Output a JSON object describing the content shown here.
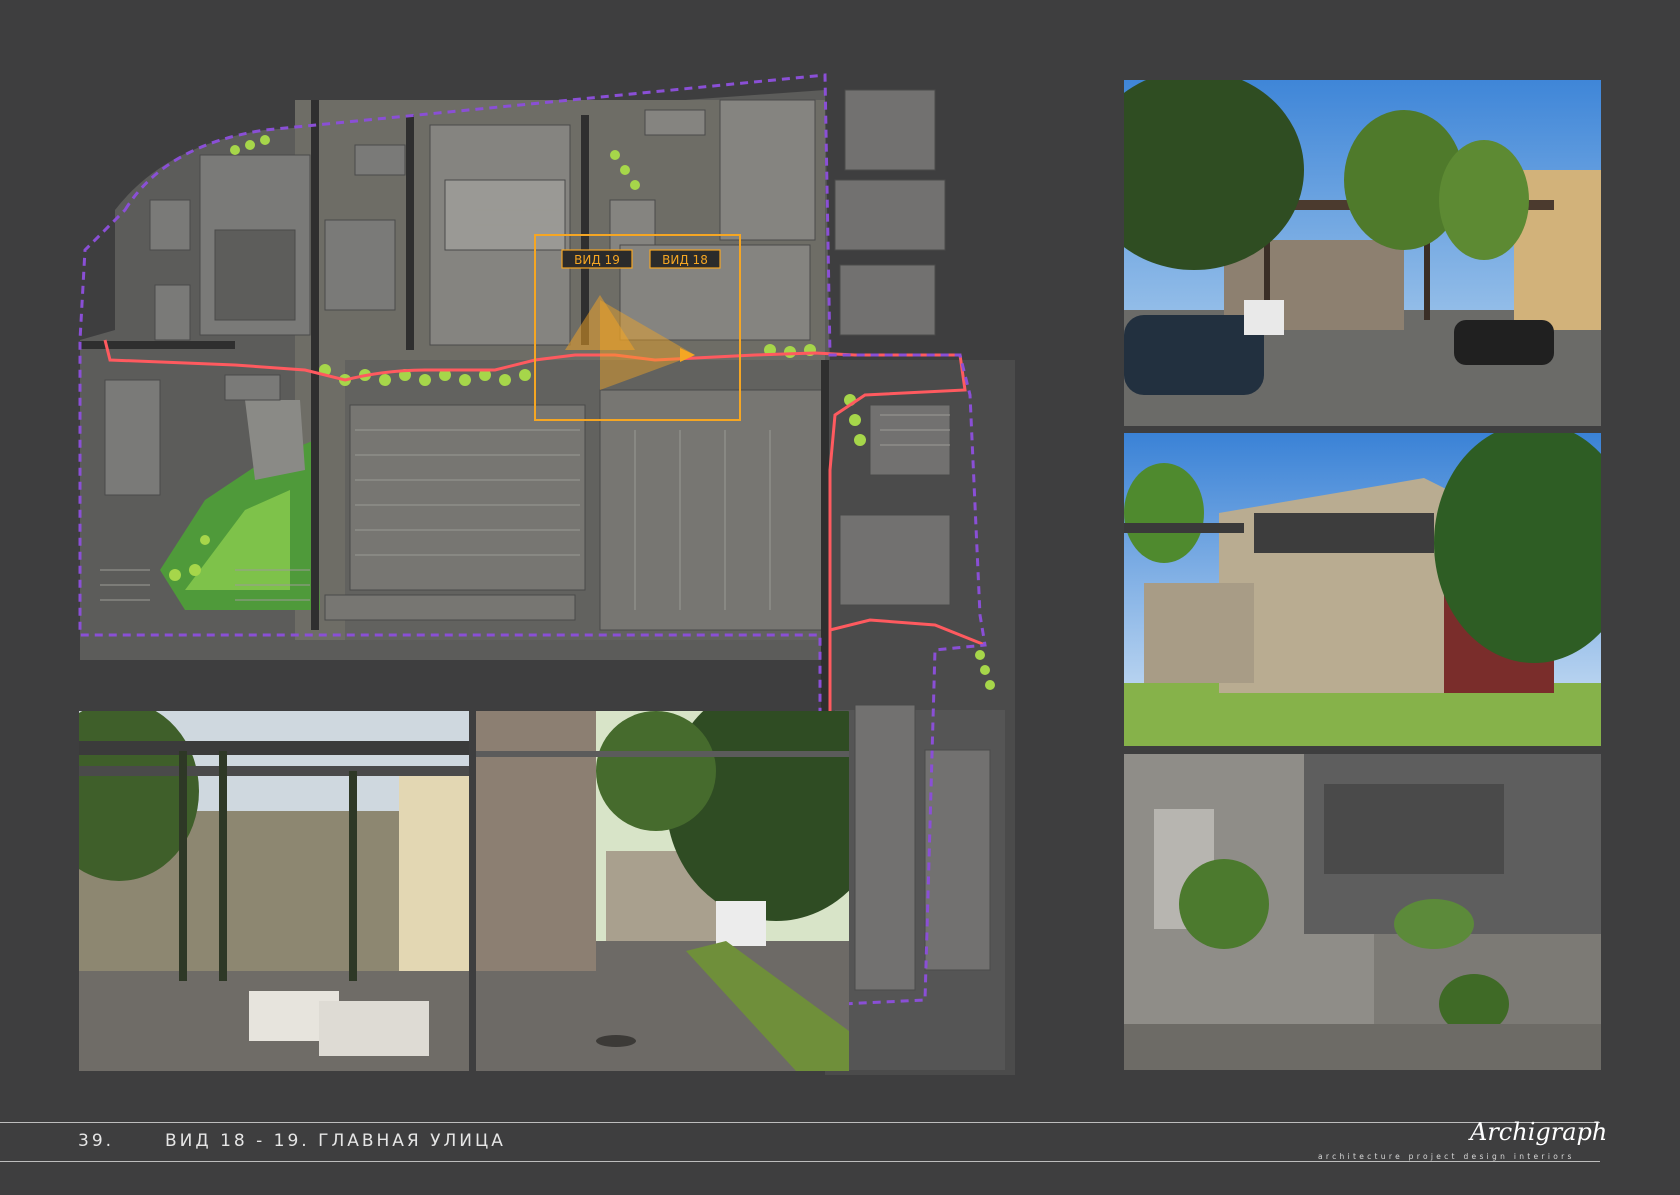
{
  "sheet": {
    "number": "39.",
    "title": "ВИД 18 - 19. ГЛАВНАЯ УЛИЦА"
  },
  "plan": {
    "view_labels": [
      "ВИД 19",
      "ВИД 18"
    ]
  },
  "brand": {
    "logo": "Archigraph",
    "tagline": "architecture  project  design  interiors"
  },
  "colors": {
    "background": "#3e3e3f",
    "boundary": "#8a4fd6",
    "route": "#ff5a5f",
    "highlight": "#f5a623",
    "greenery": "#9ccf3b"
  },
  "photos": [
    {
      "id": "street-pipe-bridge"
    },
    {
      "id": "brick-facade"
    },
    {
      "id": "aerial-roofs"
    },
    {
      "id": "pipe-rack-blocks"
    },
    {
      "id": "alley-van"
    }
  ]
}
